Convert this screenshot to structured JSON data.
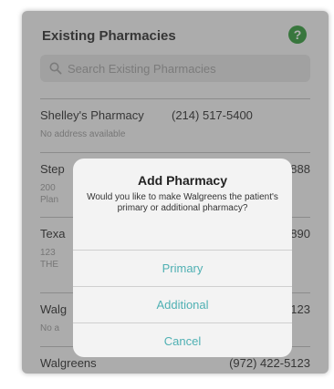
{
  "header": {
    "title": "Existing Pharmacies",
    "help_glyph": "?"
  },
  "search": {
    "placeholder": "Search Existing Pharmacies"
  },
  "pharmacies": [
    {
      "name": "Shelley's Pharmacy",
      "phone": "(214) 517-5400",
      "address": "No address available"
    },
    {
      "name": "Step",
      "phone": "888",
      "address_lines": [
        "200",
        "Plan"
      ]
    },
    {
      "name": "Texa",
      "phone": "7890",
      "address_lines": [
        "123",
        "THE"
      ]
    },
    {
      "name": "Walg",
      "phone": "5123",
      "address": "No a"
    },
    {
      "name": "Walgreens",
      "phone": "(972) 422-5123"
    }
  ],
  "dialog": {
    "title": "Add Pharmacy",
    "message": "Would you like to make Walgreens the patient's primary or additional pharmacy?",
    "buttons": {
      "primary": "Primary",
      "additional": "Additional",
      "cancel": "Cancel"
    }
  },
  "colors": {
    "accent": "#4fb0b3",
    "help_green": "#2f9a38"
  },
  "icons": [
    "help-icon",
    "search-icon"
  ]
}
